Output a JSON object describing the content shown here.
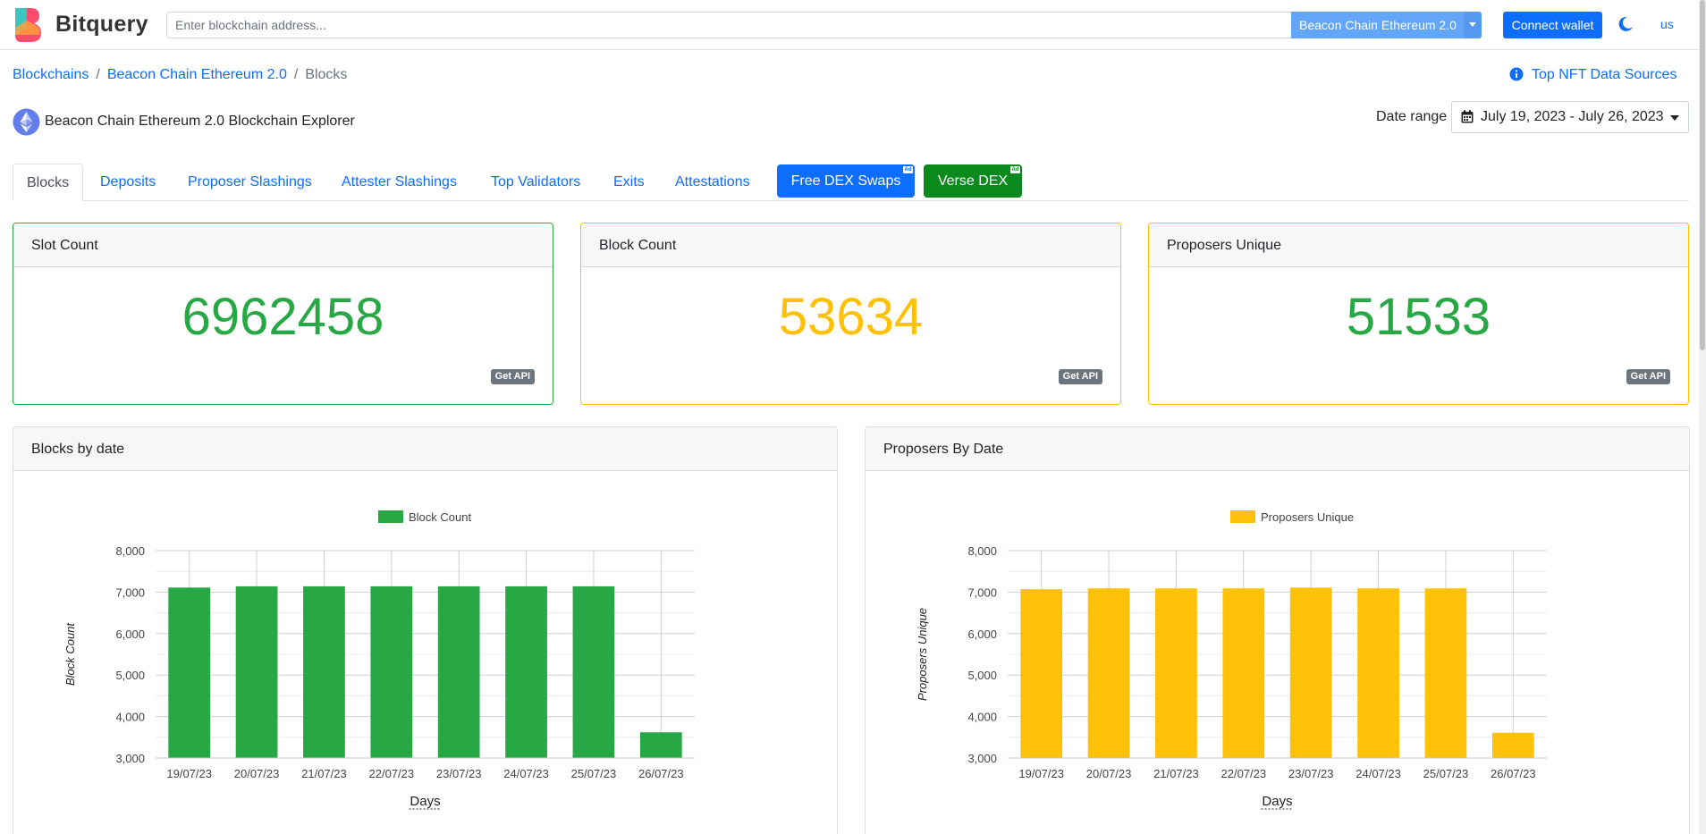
{
  "header": {
    "brand": "Bitquery",
    "search_placeholder": "Enter blockchain address...",
    "chain_select": "Beacon Chain Ethereum 2.0",
    "connect_wallet": "Connect wallet",
    "language": "us"
  },
  "breadcrumb": {
    "items": [
      "Blockchains",
      "Beacon Chain Ethereum 2.0"
    ],
    "current": "Blocks"
  },
  "nft_link": "Top NFT Data Sources",
  "explorer_title": "Beacon Chain Ethereum 2.0 Blockchain Explorer",
  "date_range": {
    "label": "Date range",
    "value": "July 19, 2023 - July 26, 2023"
  },
  "tabs": [
    {
      "label": "Blocks",
      "active": true
    },
    {
      "label": "Deposits"
    },
    {
      "label": "Proposer Slashings"
    },
    {
      "label": "Attester Slashings"
    },
    {
      "label": "Top Validators"
    },
    {
      "label": "Exits"
    },
    {
      "label": "Attestations"
    }
  ],
  "ad_buttons": [
    {
      "label": "Free DEX Swaps",
      "tag": "Ad",
      "color": "#0d6efd"
    },
    {
      "label": "Verse DEX",
      "tag": "Ad",
      "color": "#0a8a1c"
    }
  ],
  "stats": [
    {
      "title": "Slot Count",
      "value": "6962458",
      "color": "#28a745",
      "api": "Get API"
    },
    {
      "title": "Block Count",
      "value": "53634",
      "color": "#ffc107",
      "api": "Get API"
    },
    {
      "title": "Proposers Unique",
      "value": "51533",
      "color": "#28a745",
      "api": "Get API"
    }
  ],
  "colors": {
    "green": "#28a745",
    "yellow": "#ffc107",
    "link": "#0d6efd"
  },
  "chart_data": [
    {
      "type": "bar",
      "title": "Blocks by date",
      "categories": [
        "19/07/23",
        "20/07/23",
        "21/07/23",
        "22/07/23",
        "23/07/23",
        "24/07/23",
        "25/07/23",
        "26/07/23"
      ],
      "series": [
        {
          "name": "Block Count",
          "values": [
            7110,
            7140,
            7140,
            7140,
            7140,
            7140,
            7140,
            3620
          ],
          "color": "#28a745"
        }
      ],
      "xlabel": "Days",
      "ylabel": "Block Count",
      "ylim": [
        3000,
        8000
      ],
      "yticks": [
        "8,000",
        "7,000",
        "6,000",
        "5,000",
        "4,000",
        "3,000"
      ],
      "legend": "top-center",
      "grid": true
    },
    {
      "type": "bar",
      "title": "Proposers By Date",
      "categories": [
        "19/07/23",
        "20/07/23",
        "21/07/23",
        "22/07/23",
        "23/07/23",
        "24/07/23",
        "25/07/23",
        "26/07/23"
      ],
      "series": [
        {
          "name": "Proposers Unique",
          "values": [
            7070,
            7090,
            7090,
            7090,
            7110,
            7090,
            7090,
            3610
          ],
          "color": "#ffc107"
        }
      ],
      "xlabel": "Days",
      "ylabel": "Proposers Unique",
      "ylim": [
        3000,
        8000
      ],
      "yticks": [
        "8,000",
        "7,000",
        "6,000",
        "5,000",
        "4,000",
        "3,000"
      ],
      "legend": "top-center",
      "grid": true
    }
  ]
}
